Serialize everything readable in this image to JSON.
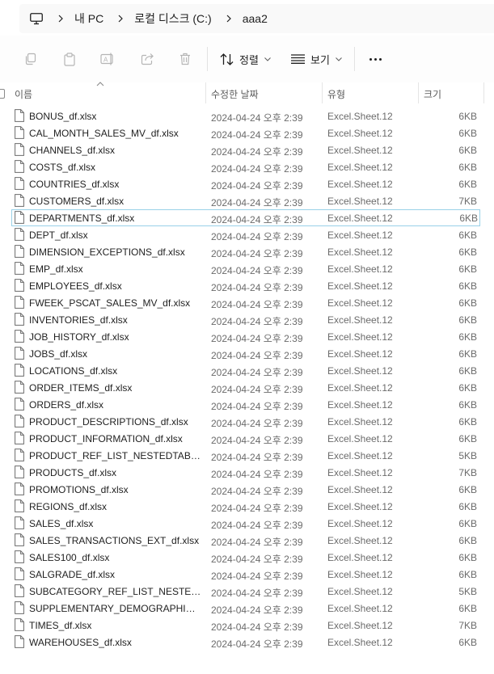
{
  "breadcrumb": {
    "items": [
      "내 PC",
      "로컬 디스크 (C:)",
      "aaa2"
    ]
  },
  "toolbar": {
    "sort_label": "정렬",
    "view_label": "보기"
  },
  "columns": {
    "name": "이름",
    "modified": "수정한 날짜",
    "type": "유형",
    "size": "크기"
  },
  "files": [
    {
      "name": "BONUS_df.xlsx",
      "modified": "2024-04-24 오후 2:39",
      "type": "Excel.Sheet.12",
      "size": "6KB"
    },
    {
      "name": "CAL_MONTH_SALES_MV_df.xlsx",
      "modified": "2024-04-24 오후 2:39",
      "type": "Excel.Sheet.12",
      "size": "6KB"
    },
    {
      "name": "CHANNELS_df.xlsx",
      "modified": "2024-04-24 오후 2:39",
      "type": "Excel.Sheet.12",
      "size": "6KB"
    },
    {
      "name": "COSTS_df.xlsx",
      "modified": "2024-04-24 오후 2:39",
      "type": "Excel.Sheet.12",
      "size": "6KB"
    },
    {
      "name": "COUNTRIES_df.xlsx",
      "modified": "2024-04-24 오후 2:39",
      "type": "Excel.Sheet.12",
      "size": "6KB"
    },
    {
      "name": "CUSTOMERS_df.xlsx",
      "modified": "2024-04-24 오후 2:39",
      "type": "Excel.Sheet.12",
      "size": "7KB"
    },
    {
      "name": "DEPARTMENTS_df.xlsx",
      "modified": "2024-04-24 오후 2:39",
      "type": "Excel.Sheet.12",
      "size": "6KB"
    },
    {
      "name": "DEPT_df.xlsx",
      "modified": "2024-04-24 오후 2:39",
      "type": "Excel.Sheet.12",
      "size": "6KB"
    },
    {
      "name": "DIMENSION_EXCEPTIONS_df.xlsx",
      "modified": "2024-04-24 오후 2:39",
      "type": "Excel.Sheet.12",
      "size": "6KB"
    },
    {
      "name": "EMP_df.xlsx",
      "modified": "2024-04-24 오후 2:39",
      "type": "Excel.Sheet.12",
      "size": "6KB"
    },
    {
      "name": "EMPLOYEES_df.xlsx",
      "modified": "2024-04-24 오후 2:39",
      "type": "Excel.Sheet.12",
      "size": "6KB"
    },
    {
      "name": "FWEEK_PSCAT_SALES_MV_df.xlsx",
      "modified": "2024-04-24 오후 2:39",
      "type": "Excel.Sheet.12",
      "size": "6KB"
    },
    {
      "name": "INVENTORIES_df.xlsx",
      "modified": "2024-04-24 오후 2:39",
      "type": "Excel.Sheet.12",
      "size": "6KB"
    },
    {
      "name": "JOB_HISTORY_df.xlsx",
      "modified": "2024-04-24 오후 2:39",
      "type": "Excel.Sheet.12",
      "size": "6KB"
    },
    {
      "name": "JOBS_df.xlsx",
      "modified": "2024-04-24 오후 2:39",
      "type": "Excel.Sheet.12",
      "size": "6KB"
    },
    {
      "name": "LOCATIONS_df.xlsx",
      "modified": "2024-04-24 오후 2:39",
      "type": "Excel.Sheet.12",
      "size": "6KB"
    },
    {
      "name": "ORDER_ITEMS_df.xlsx",
      "modified": "2024-04-24 오후 2:39",
      "type": "Excel.Sheet.12",
      "size": "6KB"
    },
    {
      "name": "ORDERS_df.xlsx",
      "modified": "2024-04-24 오후 2:39",
      "type": "Excel.Sheet.12",
      "size": "6KB"
    },
    {
      "name": "PRODUCT_DESCRIPTIONS_df.xlsx",
      "modified": "2024-04-24 오후 2:39",
      "type": "Excel.Sheet.12",
      "size": "6KB"
    },
    {
      "name": "PRODUCT_INFORMATION_df.xlsx",
      "modified": "2024-04-24 오후 2:39",
      "type": "Excel.Sheet.12",
      "size": "6KB"
    },
    {
      "name": "PRODUCT_REF_LIST_NESTEDTAB_df.xl...",
      "modified": "2024-04-24 오후 2:39",
      "type": "Excel.Sheet.12",
      "size": "5KB"
    },
    {
      "name": "PRODUCTS_df.xlsx",
      "modified": "2024-04-24 오후 2:39",
      "type": "Excel.Sheet.12",
      "size": "7KB"
    },
    {
      "name": "PROMOTIONS_df.xlsx",
      "modified": "2024-04-24 오후 2:39",
      "type": "Excel.Sheet.12",
      "size": "6KB"
    },
    {
      "name": "REGIONS_df.xlsx",
      "modified": "2024-04-24 오후 2:39",
      "type": "Excel.Sheet.12",
      "size": "6KB"
    },
    {
      "name": "SALES_df.xlsx",
      "modified": "2024-04-24 오후 2:39",
      "type": "Excel.Sheet.12",
      "size": "6KB"
    },
    {
      "name": "SALES_TRANSACTIONS_EXT_df.xlsx",
      "modified": "2024-04-24 오후 2:39",
      "type": "Excel.Sheet.12",
      "size": "6KB"
    },
    {
      "name": "SALES100_df.xlsx",
      "modified": "2024-04-24 오후 2:39",
      "type": "Excel.Sheet.12",
      "size": "6KB"
    },
    {
      "name": "SALGRADE_df.xlsx",
      "modified": "2024-04-24 오후 2:39",
      "type": "Excel.Sheet.12",
      "size": "6KB"
    },
    {
      "name": "SUBCATEGORY_REF_LIST_NESTEDTAB...",
      "modified": "2024-04-24 오후 2:39",
      "type": "Excel.Sheet.12",
      "size": "5KB"
    },
    {
      "name": "SUPPLEMENTARY_DEMOGRAPHICS_...",
      "modified": "2024-04-24 오후 2:39",
      "type": "Excel.Sheet.12",
      "size": "6KB"
    },
    {
      "name": "TIMES_df.xlsx",
      "modified": "2024-04-24 오후 2:39",
      "type": "Excel.Sheet.12",
      "size": "7KB"
    },
    {
      "name": "WAREHOUSES_df.xlsx",
      "modified": "2024-04-24 오후 2:39",
      "type": "Excel.Sheet.12",
      "size": "6KB"
    }
  ],
  "selected_index": 6,
  "colors": {
    "selection_outline": "#99d1e8",
    "header_text": "#5c5c5c",
    "secondary_text": "#6b6b6b",
    "disabled_icon": "#b5b5b5"
  }
}
